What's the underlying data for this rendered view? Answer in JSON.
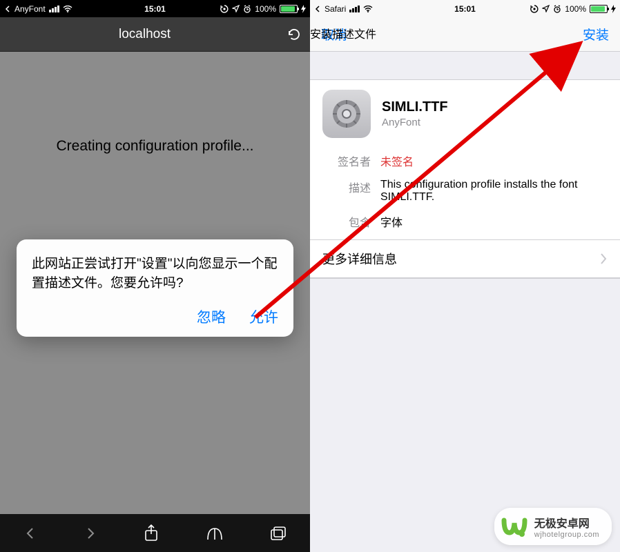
{
  "left": {
    "status": {
      "back_app": "AnyFont",
      "time": "15:01",
      "battery_pct": "100%"
    },
    "url": "localhost",
    "main_message": "Creating configuration profile...",
    "alert": {
      "message": "此网站正尝试打开\"设置\"以向您显示一个配置描述文件。您要允许吗?",
      "ignore": "忽略",
      "allow": "允许"
    }
  },
  "right": {
    "status": {
      "back_app": "Safari",
      "time": "15:01",
      "battery_pct": "100%"
    },
    "nav": {
      "cancel": "取消",
      "title": "安装描述文件",
      "install": "安装"
    },
    "profile": {
      "title": "SIMLI.TTF",
      "subtitle": "AnyFont",
      "rows": {
        "signer_label": "签名者",
        "signer_value": "未签名",
        "desc_label": "描述",
        "desc_value": "This configuration profile installs the font SIMLI.TTF.",
        "contains_label": "包含",
        "contains_value": "字体"
      },
      "more": "更多详细信息"
    }
  },
  "watermark": {
    "brand": "无极安卓网",
    "url": "wjhotelgroup.com"
  },
  "colors": {
    "accent": "#007aff",
    "danger": "#d33",
    "battery": "#4cd964"
  }
}
